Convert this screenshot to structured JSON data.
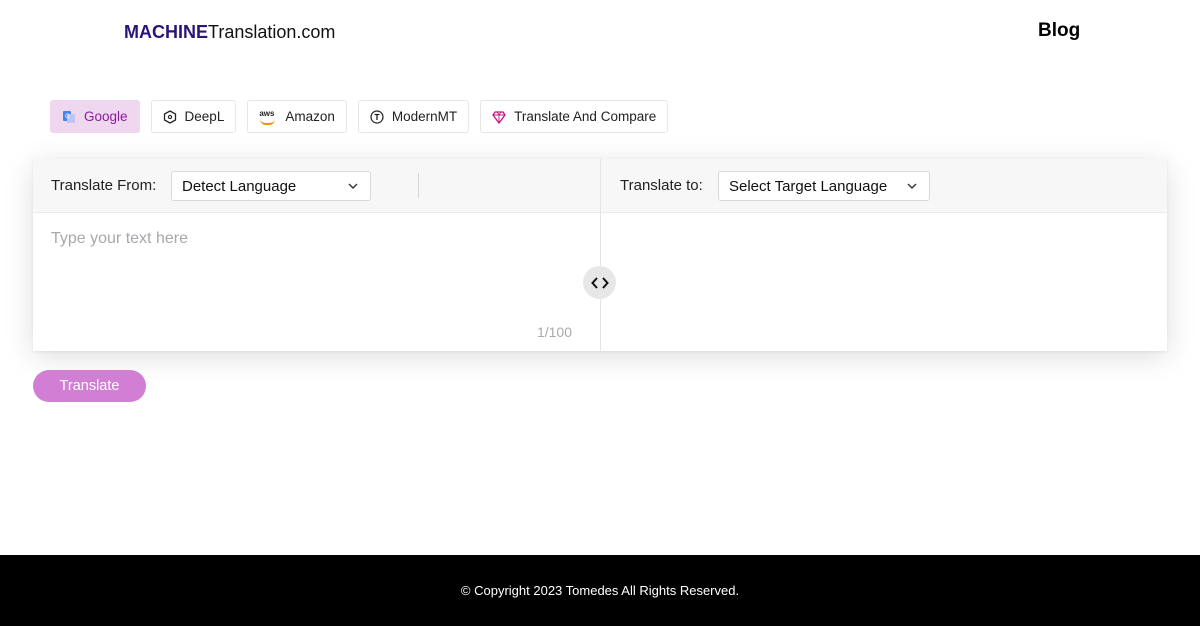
{
  "header": {
    "logo_strong": "MACHINE",
    "logo_rest": "Translation.com",
    "blog_label": "Blog"
  },
  "engines": {
    "items": [
      {
        "label": "Google",
        "icon": "google-translate-icon",
        "active": true
      },
      {
        "label": "DeepL",
        "icon": "deepl-icon",
        "active": false
      },
      {
        "label": "Amazon",
        "icon": "aws-icon",
        "active": false
      },
      {
        "label": "ModernMT",
        "icon": "modernmt-icon",
        "active": false
      },
      {
        "label": "Translate And Compare",
        "icon": "gem-icon",
        "active": false
      }
    ],
    "aws_text": "aws"
  },
  "translator": {
    "from_label": "Translate From:",
    "from_value": "Detect Language",
    "to_label": "Translate to:",
    "to_value": "Select Target Language",
    "input_placeholder": "Type your text here",
    "counter": "1/100",
    "swap_icon": "swap-arrows-icon"
  },
  "actions": {
    "translate_label": "Translate"
  },
  "footer": {
    "copyright": "© Copyright 2023 Tomedes All Rights Reserved."
  },
  "colors": {
    "brand": "#2a1478",
    "active_tab_bg": "#efd8ef",
    "active_tab_text": "#8a1b9e",
    "translate_button": "#d17ed4",
    "footer_bg": "#000000"
  }
}
